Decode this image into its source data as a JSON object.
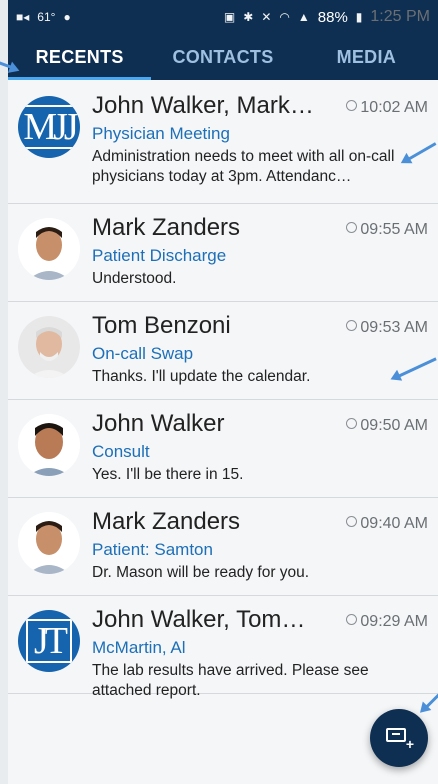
{
  "status_bar": {
    "temperature": "61°",
    "battery_percent": "88%",
    "time": "1:25 PM"
  },
  "tabs": [
    {
      "label": "RECENTS",
      "active": true
    },
    {
      "label": "CONTACTS",
      "active": false
    },
    {
      "label": "MEDIA",
      "active": false
    }
  ],
  "conversations": [
    {
      "name": "John Walker, Mark…",
      "time": "10:02 AM",
      "subject": "Physician Meeting",
      "preview": "Administration needs to meet with all on-call physicians today at 3pm. Attendanc…",
      "avatar": "initials",
      "initials": "MJJ"
    },
    {
      "name": "Mark Zanders",
      "time": "09:55 AM",
      "subject": "Patient Discharge",
      "preview": "Understood.",
      "avatar": "photo"
    },
    {
      "name": "Tom Benzoni",
      "time": "09:53 AM",
      "subject": "On-call Swap",
      "preview": "Thanks. I'll update the calendar.",
      "avatar": "photo"
    },
    {
      "name": "John Walker",
      "time": "09:50 AM",
      "subject": "Consult",
      "preview": "Yes. I'll be there in 15.",
      "avatar": "photo"
    },
    {
      "name": "Mark Zanders",
      "time": "09:40 AM",
      "subject": "Patient: Samton",
      "preview": "Dr. Mason will be ready for you.",
      "avatar": "photo"
    },
    {
      "name": "John Walker, Tom…",
      "time": "09:29 AM",
      "subject": "McMartin, Al",
      "preview": "The lab results have arrived. Please see attached report.",
      "avatar": "initials",
      "initials": "JT"
    }
  ],
  "colors": {
    "header": "#0e2f52",
    "accent": "#1d6fb8",
    "tab_indicator": "#49a8f0"
  }
}
